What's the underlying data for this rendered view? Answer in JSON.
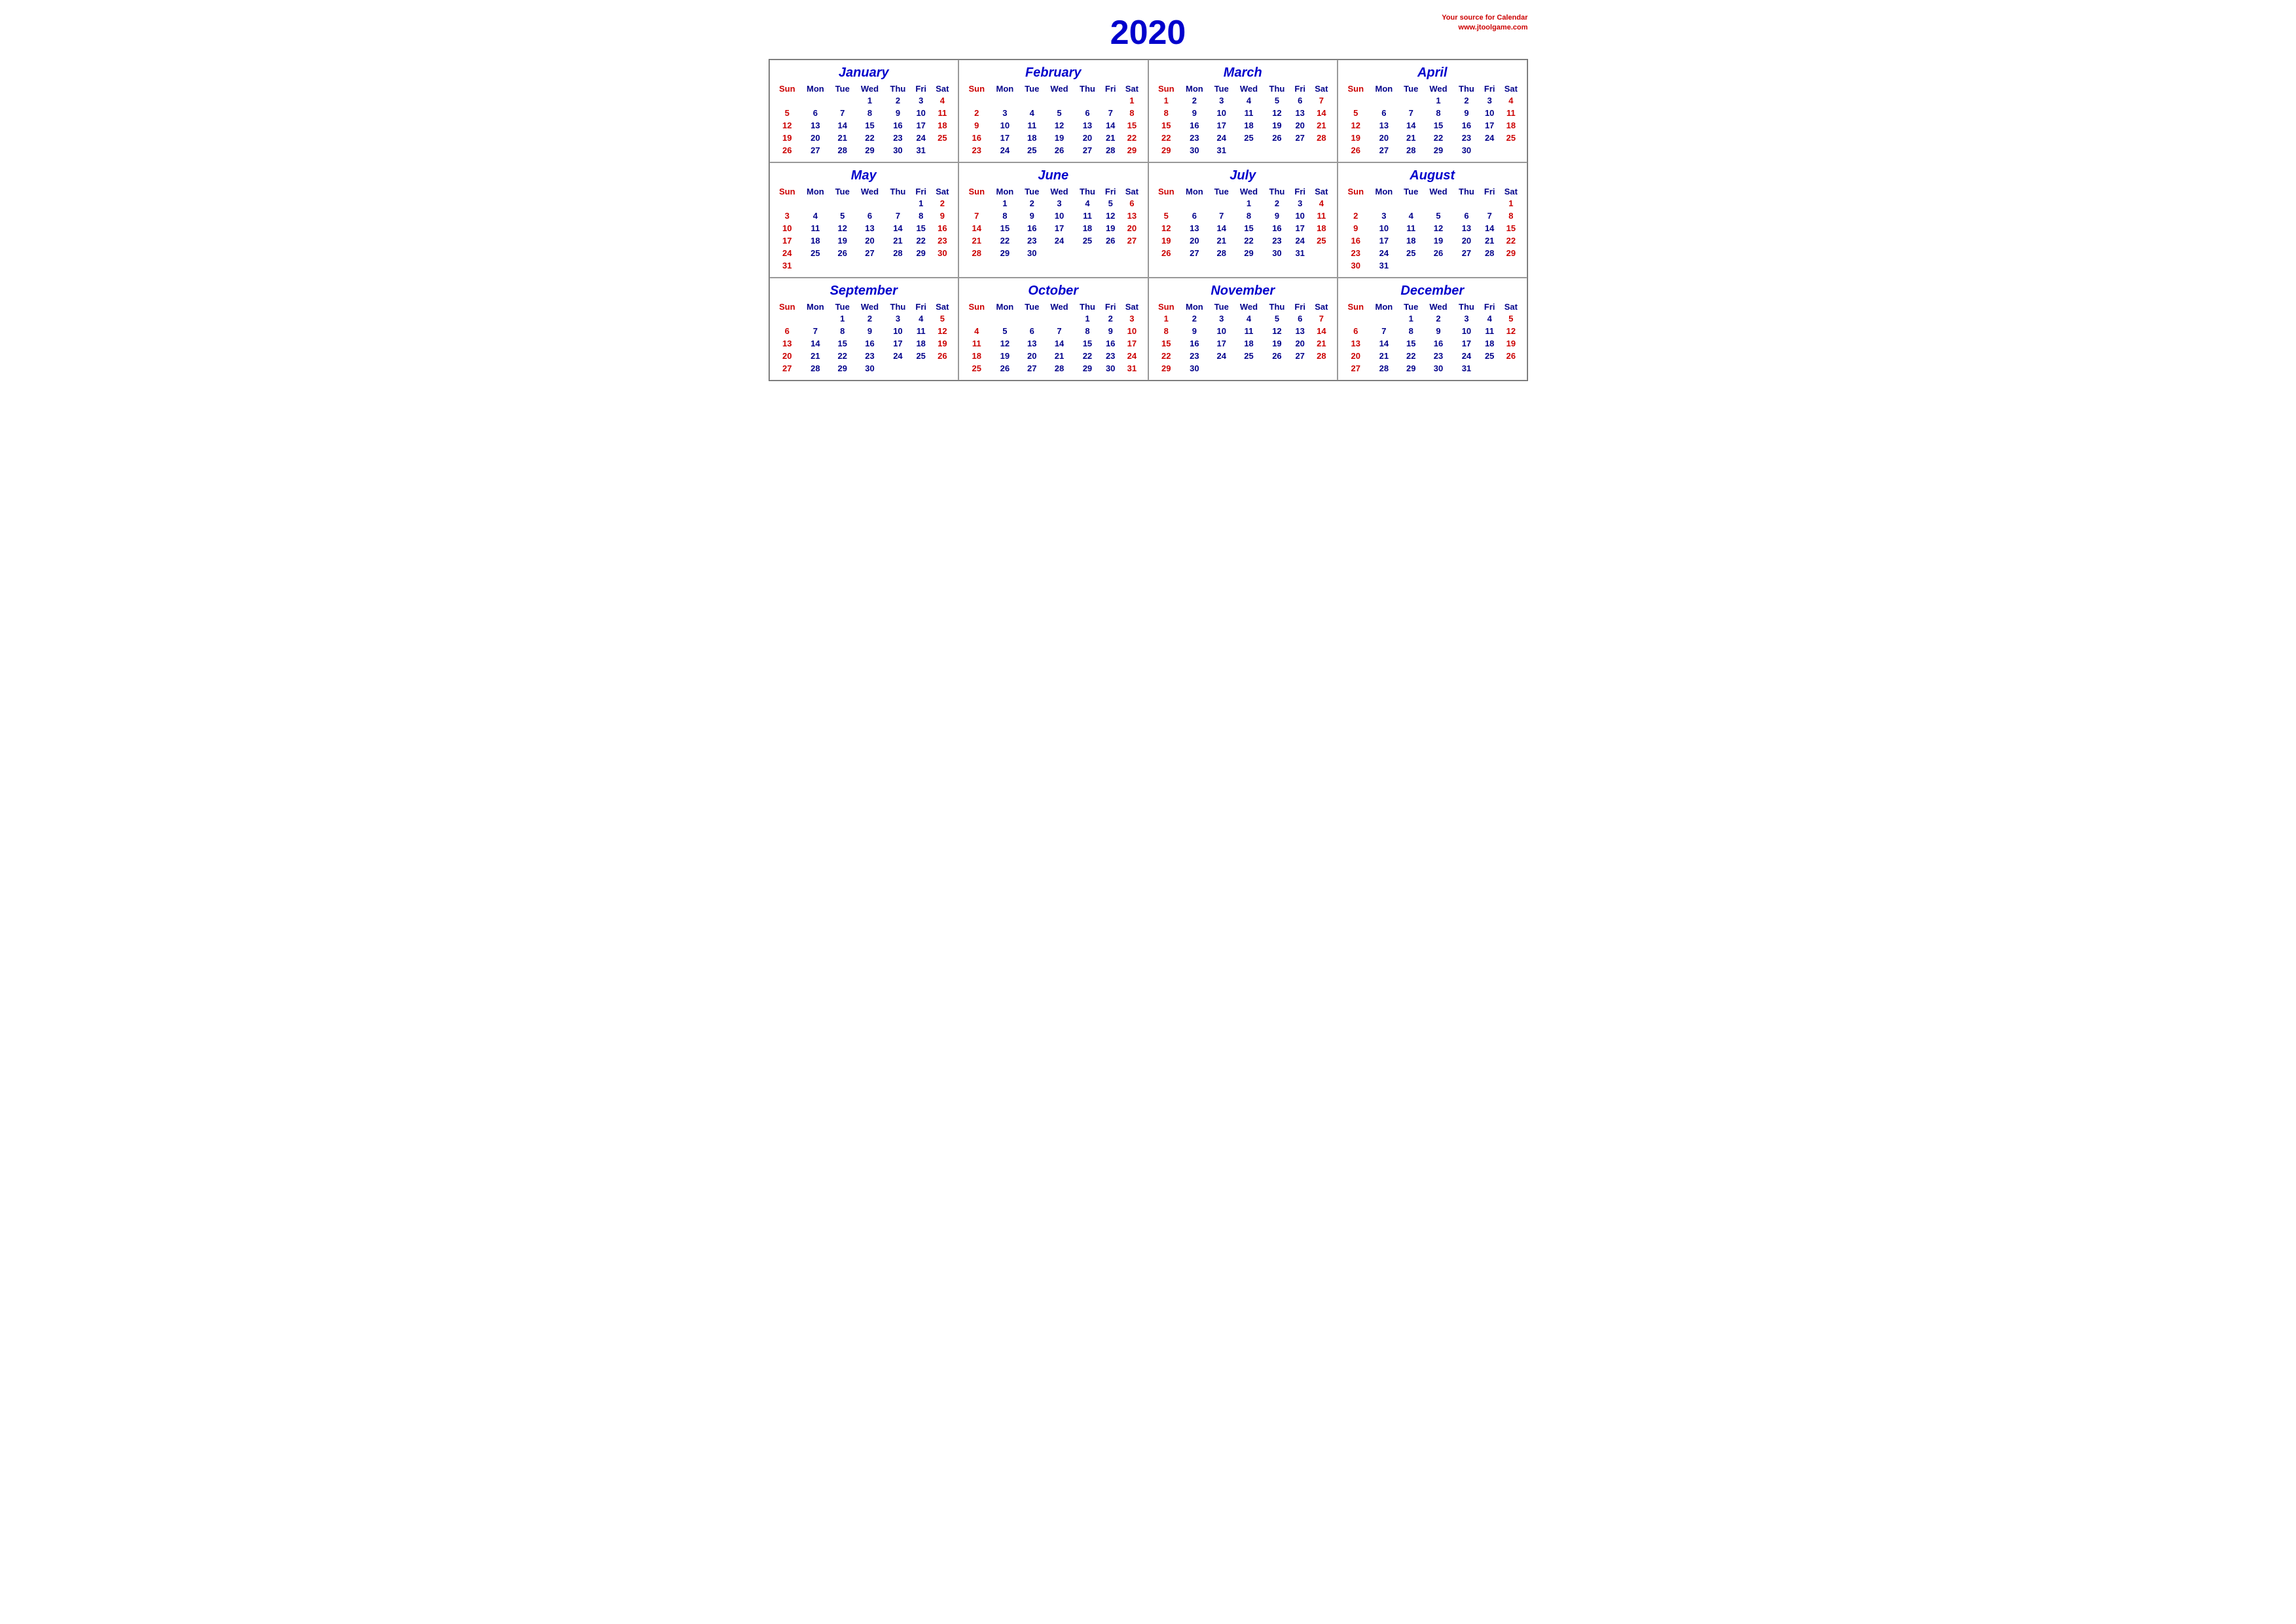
{
  "header": {
    "year": "2020",
    "site_line1": "Your source for Calendar",
    "site_line2": "www.jtoolgame.com"
  },
  "months": [
    {
      "name": "January",
      "days": [
        [
          "",
          "",
          "",
          "1",
          "2",
          "3",
          "4"
        ],
        [
          "5",
          "6",
          "7",
          "8",
          "9",
          "10",
          "11"
        ],
        [
          "12",
          "13",
          "14",
          "15",
          "16",
          "17",
          "18"
        ],
        [
          "19",
          "20",
          "21",
          "22",
          "23",
          "24",
          "25"
        ],
        [
          "26",
          "27",
          "28",
          "29",
          "30",
          "31",
          ""
        ]
      ]
    },
    {
      "name": "February",
      "days": [
        [
          "",
          "",
          "",
          "",
          "",
          "",
          "1"
        ],
        [
          "2",
          "3",
          "4",
          "5",
          "6",
          "7",
          "8"
        ],
        [
          "9",
          "10",
          "11",
          "12",
          "13",
          "14",
          "15"
        ],
        [
          "16",
          "17",
          "18",
          "19",
          "20",
          "21",
          "22"
        ],
        [
          "23",
          "24",
          "25",
          "26",
          "27",
          "28",
          "29"
        ]
      ]
    },
    {
      "name": "March",
      "days": [
        [
          "1",
          "2",
          "3",
          "4",
          "5",
          "6",
          "7"
        ],
        [
          "8",
          "9",
          "10",
          "11",
          "12",
          "13",
          "14"
        ],
        [
          "15",
          "16",
          "17",
          "18",
          "19",
          "20",
          "21"
        ],
        [
          "22",
          "23",
          "24",
          "25",
          "26",
          "27",
          "28"
        ],
        [
          "29",
          "30",
          "31",
          "",
          "",
          "",
          ""
        ]
      ]
    },
    {
      "name": "April",
      "days": [
        [
          "",
          "",
          "",
          "1",
          "2",
          "3",
          "4"
        ],
        [
          "5",
          "6",
          "7",
          "8",
          "9",
          "10",
          "11"
        ],
        [
          "12",
          "13",
          "14",
          "15",
          "16",
          "17",
          "18"
        ],
        [
          "19",
          "20",
          "21",
          "22",
          "23",
          "24",
          "25"
        ],
        [
          "26",
          "27",
          "28",
          "29",
          "30",
          "",
          ""
        ]
      ]
    },
    {
      "name": "May",
      "days": [
        [
          "",
          "",
          "",
          "",
          "",
          "1",
          "2"
        ],
        [
          "3",
          "4",
          "5",
          "6",
          "7",
          "8",
          "9"
        ],
        [
          "10",
          "11",
          "12",
          "13",
          "14",
          "15",
          "16"
        ],
        [
          "17",
          "18",
          "19",
          "20",
          "21",
          "22",
          "23"
        ],
        [
          "24",
          "25",
          "26",
          "27",
          "28",
          "29",
          "30"
        ],
        [
          "31",
          "",
          "",
          "",
          "",
          "",
          ""
        ]
      ]
    },
    {
      "name": "June",
      "days": [
        [
          "",
          "1",
          "2",
          "3",
          "4",
          "5",
          "6"
        ],
        [
          "7",
          "8",
          "9",
          "10",
          "11",
          "12",
          "13"
        ],
        [
          "14",
          "15",
          "16",
          "17",
          "18",
          "19",
          "20"
        ],
        [
          "21",
          "22",
          "23",
          "24",
          "25",
          "26",
          "27"
        ],
        [
          "28",
          "29",
          "30",
          "",
          "",
          "",
          ""
        ]
      ]
    },
    {
      "name": "July",
      "days": [
        [
          "",
          "",
          "",
          "1",
          "2",
          "3",
          "4"
        ],
        [
          "5",
          "6",
          "7",
          "8",
          "9",
          "10",
          "11"
        ],
        [
          "12",
          "13",
          "14",
          "15",
          "16",
          "17",
          "18"
        ],
        [
          "19",
          "20",
          "21",
          "22",
          "23",
          "24",
          "25"
        ],
        [
          "26",
          "27",
          "28",
          "29",
          "30",
          "31",
          ""
        ]
      ]
    },
    {
      "name": "August",
      "days": [
        [
          "",
          "",
          "",
          "",
          "",
          "",
          "1"
        ],
        [
          "2",
          "3",
          "4",
          "5",
          "6",
          "7",
          "8"
        ],
        [
          "9",
          "10",
          "11",
          "12",
          "13",
          "14",
          "15"
        ],
        [
          "16",
          "17",
          "18",
          "19",
          "20",
          "21",
          "22"
        ],
        [
          "23",
          "24",
          "25",
          "26",
          "27",
          "28",
          "29"
        ],
        [
          "30",
          "31",
          "",
          "",
          "",
          "",
          ""
        ]
      ]
    },
    {
      "name": "September",
      "days": [
        [
          "",
          "",
          "1",
          "2",
          "3",
          "4",
          "5"
        ],
        [
          "6",
          "7",
          "8",
          "9",
          "10",
          "11",
          "12"
        ],
        [
          "13",
          "14",
          "15",
          "16",
          "17",
          "18",
          "19"
        ],
        [
          "20",
          "21",
          "22",
          "23",
          "24",
          "25",
          "26"
        ],
        [
          "27",
          "28",
          "29",
          "30",
          "",
          "",
          ""
        ]
      ]
    },
    {
      "name": "October",
      "days": [
        [
          "",
          "",
          "",
          "",
          "1",
          "2",
          "3"
        ],
        [
          "4",
          "5",
          "6",
          "7",
          "8",
          "9",
          "10"
        ],
        [
          "11",
          "12",
          "13",
          "14",
          "15",
          "16",
          "17"
        ],
        [
          "18",
          "19",
          "20",
          "21",
          "22",
          "23",
          "24"
        ],
        [
          "25",
          "26",
          "27",
          "28",
          "29",
          "30",
          "31"
        ]
      ]
    },
    {
      "name": "November",
      "days": [
        [
          "1",
          "2",
          "3",
          "4",
          "5",
          "6",
          "7"
        ],
        [
          "8",
          "9",
          "10",
          "11",
          "12",
          "13",
          "14"
        ],
        [
          "15",
          "16",
          "17",
          "18",
          "19",
          "20",
          "21"
        ],
        [
          "22",
          "23",
          "24",
          "25",
          "26",
          "27",
          "28"
        ],
        [
          "29",
          "30",
          "",
          "",
          "",
          "",
          ""
        ]
      ]
    },
    {
      "name": "December",
      "days": [
        [
          "",
          "",
          "1",
          "2",
          "3",
          "4",
          "5"
        ],
        [
          "6",
          "7",
          "8",
          "9",
          "10",
          "11",
          "12"
        ],
        [
          "13",
          "14",
          "15",
          "16",
          "17",
          "18",
          "19"
        ],
        [
          "20",
          "21",
          "22",
          "23",
          "24",
          "25",
          "26"
        ],
        [
          "27",
          "28",
          "29",
          "30",
          "31",
          "",
          ""
        ]
      ]
    }
  ],
  "weekdays": [
    "Sun",
    "Mon",
    "Tue",
    "Wed",
    "Thu",
    "Fri",
    "Sat"
  ]
}
